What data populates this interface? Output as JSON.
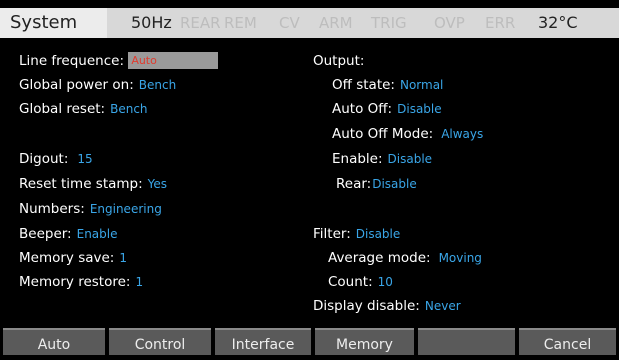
{
  "status": {
    "tab": "System",
    "indicators": [
      {
        "label": "50Hz",
        "active": true
      },
      {
        "label": "REAR",
        "active": false
      },
      {
        "label": "REM",
        "active": false
      },
      {
        "label": "CV",
        "active": false
      },
      {
        "label": "ARM",
        "active": false
      },
      {
        "label": "TRIG",
        "active": false
      },
      {
        "label": "OVP",
        "active": false
      },
      {
        "label": "ERR",
        "active": false
      }
    ],
    "temperature": "32°C"
  },
  "left": {
    "line_frequence": {
      "label": "Line frequence:",
      "value": "Auto"
    },
    "global_power_on": {
      "label": "Global power on:",
      "value": "Bench"
    },
    "global_reset": {
      "label": "Global reset:",
      "value": "Bench"
    },
    "digout": {
      "label": "Digout:",
      "value": "15"
    },
    "reset_time_stamp": {
      "label": "Reset time stamp:",
      "value": "Yes"
    },
    "numbers": {
      "label": "Numbers:",
      "value": "Engineering"
    },
    "beeper": {
      "label": "Beeper:",
      "value": "Enable"
    },
    "memory_save": {
      "label": "Memory save:",
      "value": "1"
    },
    "memory_restore": {
      "label": "Memory restore:",
      "value": "1"
    }
  },
  "right": {
    "output": {
      "label": "Output:"
    },
    "off_state": {
      "label": "Off state:",
      "value": "Normal"
    },
    "auto_off": {
      "label": "Auto Off:",
      "value": "Disable"
    },
    "auto_off_mode": {
      "label": "Auto Off Mode:",
      "value": "Always"
    },
    "enable": {
      "label": "Enable:",
      "value": "Disable"
    },
    "rear": {
      "label": "Rear:",
      "value": "Disable"
    },
    "filter": {
      "label": "Filter:",
      "value": "Disable"
    },
    "average_mode": {
      "label": "Average mode:",
      "value": "Moving"
    },
    "count": {
      "label": "Count:",
      "value": "10"
    },
    "display_disable": {
      "label": "Display disable:",
      "value": "Never"
    }
  },
  "softkeys": [
    "Auto",
    "Control",
    "Interface",
    "Memory",
    "",
    "Cancel"
  ],
  "colors": {
    "value_text": "#3aa6e8",
    "highlight_value_text": "#e23b2e",
    "highlight_background": "#9a9a9a",
    "statusbar_background": "#d8d8d8",
    "softkey_background": "#5a5a5a"
  }
}
